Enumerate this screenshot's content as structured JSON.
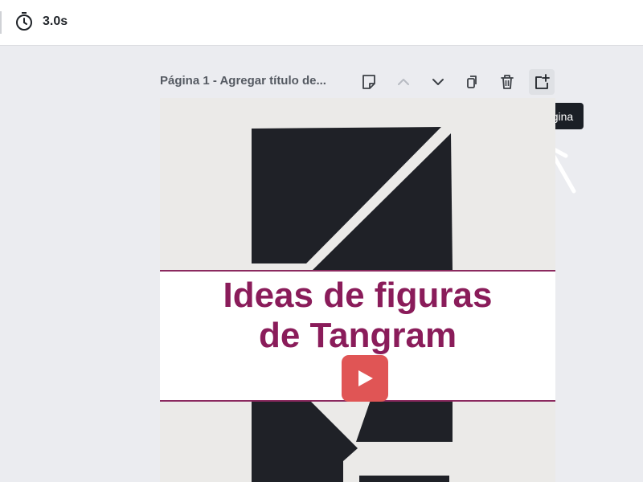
{
  "toolbar": {
    "timer_icon": "stopwatch-icon",
    "duration": "3.0s"
  },
  "page": {
    "title": "Página 1 - Agregar título de...",
    "tools": [
      {
        "name": "notes-icon"
      },
      {
        "name": "chevron-up-icon"
      },
      {
        "name": "chevron-down-icon"
      },
      {
        "name": "duplicate-icon"
      },
      {
        "name": "trash-icon"
      },
      {
        "name": "add-page-icon"
      }
    ],
    "tooltip": "Añadir página"
  },
  "design": {
    "line1": "Ideas  de figuras",
    "line2": "de Tangram",
    "play_icon": "play-icon",
    "colors": {
      "title": "#8a1c5a",
      "border": "#8b2a5f",
      "play": "#e05555",
      "tangram": "#1f2127"
    }
  }
}
